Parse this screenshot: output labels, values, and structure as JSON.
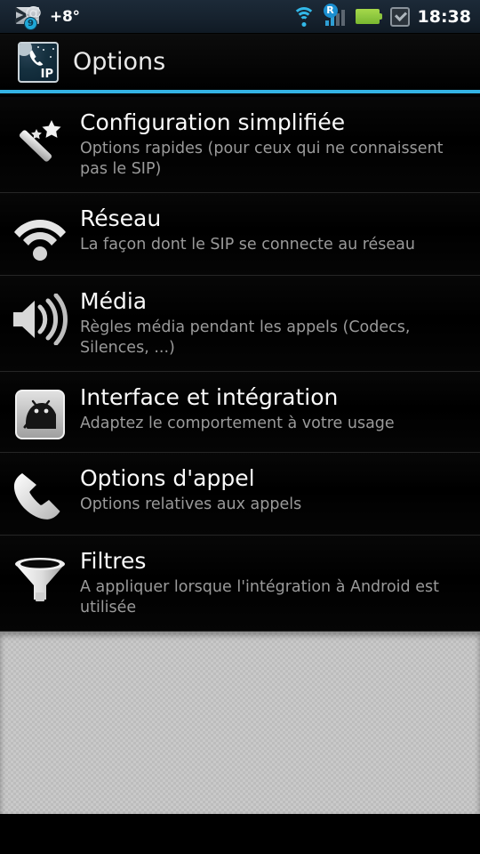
{
  "status_bar": {
    "mail_icon": "mail-at-icon",
    "mail_badge_count": "9",
    "temperature": "+8°",
    "wifi_icon": "wifi-icon",
    "signal_icon": "signal-bars-icon",
    "roaming_badge": "R",
    "battery_icon": "battery-icon",
    "check_icon": "checkbox-checked-icon",
    "clock": "18:38",
    "accent_color": "#34b3e4",
    "signal_active_color": "#2f9fd4",
    "battery_color": "#8cc63f"
  },
  "title_bar": {
    "app_icon": "csipsimple-app-icon",
    "app_icon_label": "IP",
    "title": "Options"
  },
  "preferences": [
    {
      "icon": "magic-wand-icon",
      "title": "Configuration simplifiée",
      "summary": "Options rapides (pour ceux qui ne connaissent pas le SIP)"
    },
    {
      "icon": "network-wifi-icon",
      "title": "Réseau",
      "summary": "La façon dont le SIP se connecte au réseau"
    },
    {
      "icon": "speaker-volume-icon",
      "title": "Média",
      "summary": "Règles média pendant les appels (Codecs, Silences, ...)"
    },
    {
      "icon": "android-robot-icon",
      "title": "Interface et intégration",
      "summary": "Adaptez le comportement à votre usage"
    },
    {
      "icon": "phone-handset-icon",
      "title": "Options d'appel",
      "summary": "Options relatives aux appels"
    },
    {
      "icon": "funnel-filter-icon",
      "title": "Filtres",
      "summary": "A appliquer lorsque l'intégration à Android est utilisée"
    }
  ]
}
